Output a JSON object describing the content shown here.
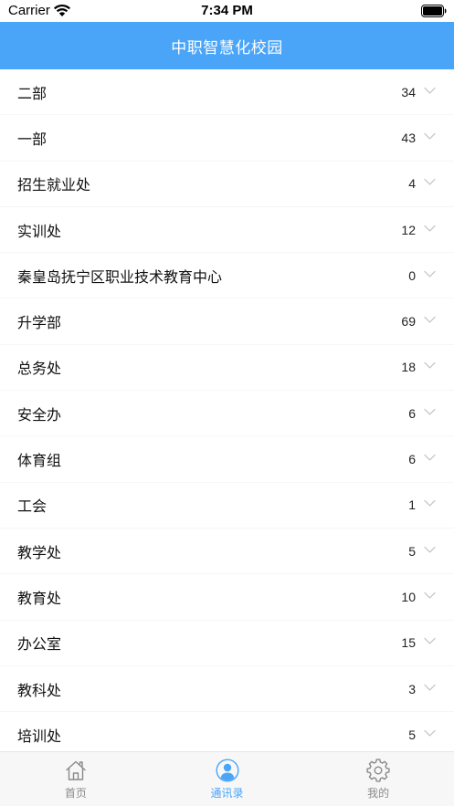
{
  "status_bar": {
    "carrier": "Carrier",
    "time": "7:34 PM"
  },
  "header": {
    "title": "中职智慧化校园"
  },
  "departments": [
    {
      "name": "二部",
      "count": "34"
    },
    {
      "name": "一部",
      "count": "43"
    },
    {
      "name": "招生就业处",
      "count": "4"
    },
    {
      "name": "实训处",
      "count": "12"
    },
    {
      "name": "秦皇岛抚宁区职业技术教育中心",
      "count": "0"
    },
    {
      "name": "升学部",
      "count": "69"
    },
    {
      "name": "总务处",
      "count": "18"
    },
    {
      "name": "安全办",
      "count": "6"
    },
    {
      "name": "体育组",
      "count": "6"
    },
    {
      "name": "工会",
      "count": "1"
    },
    {
      "name": "教学处",
      "count": "5"
    },
    {
      "name": "教育处",
      "count": "10"
    },
    {
      "name": "办公室",
      "count": "15"
    },
    {
      "name": "教科处",
      "count": "3"
    },
    {
      "name": "培训处",
      "count": "5"
    }
  ],
  "icons": {
    "row_expand": "chevron-down-icon",
    "home": "home-icon",
    "contacts": "contacts-icon",
    "settings": "gear-icon"
  },
  "tabbar": {
    "tabs": [
      {
        "label": "首页",
        "icon": "home-icon",
        "active": false
      },
      {
        "label": "通讯录",
        "icon": "contacts-icon",
        "active": true
      },
      {
        "label": "我的",
        "icon": "gear-icon",
        "active": false
      }
    ]
  },
  "colors": {
    "accent": "#4aa5f9",
    "inactive": "#8a8a8a",
    "tabbar_bg": "#f7f7f7"
  }
}
